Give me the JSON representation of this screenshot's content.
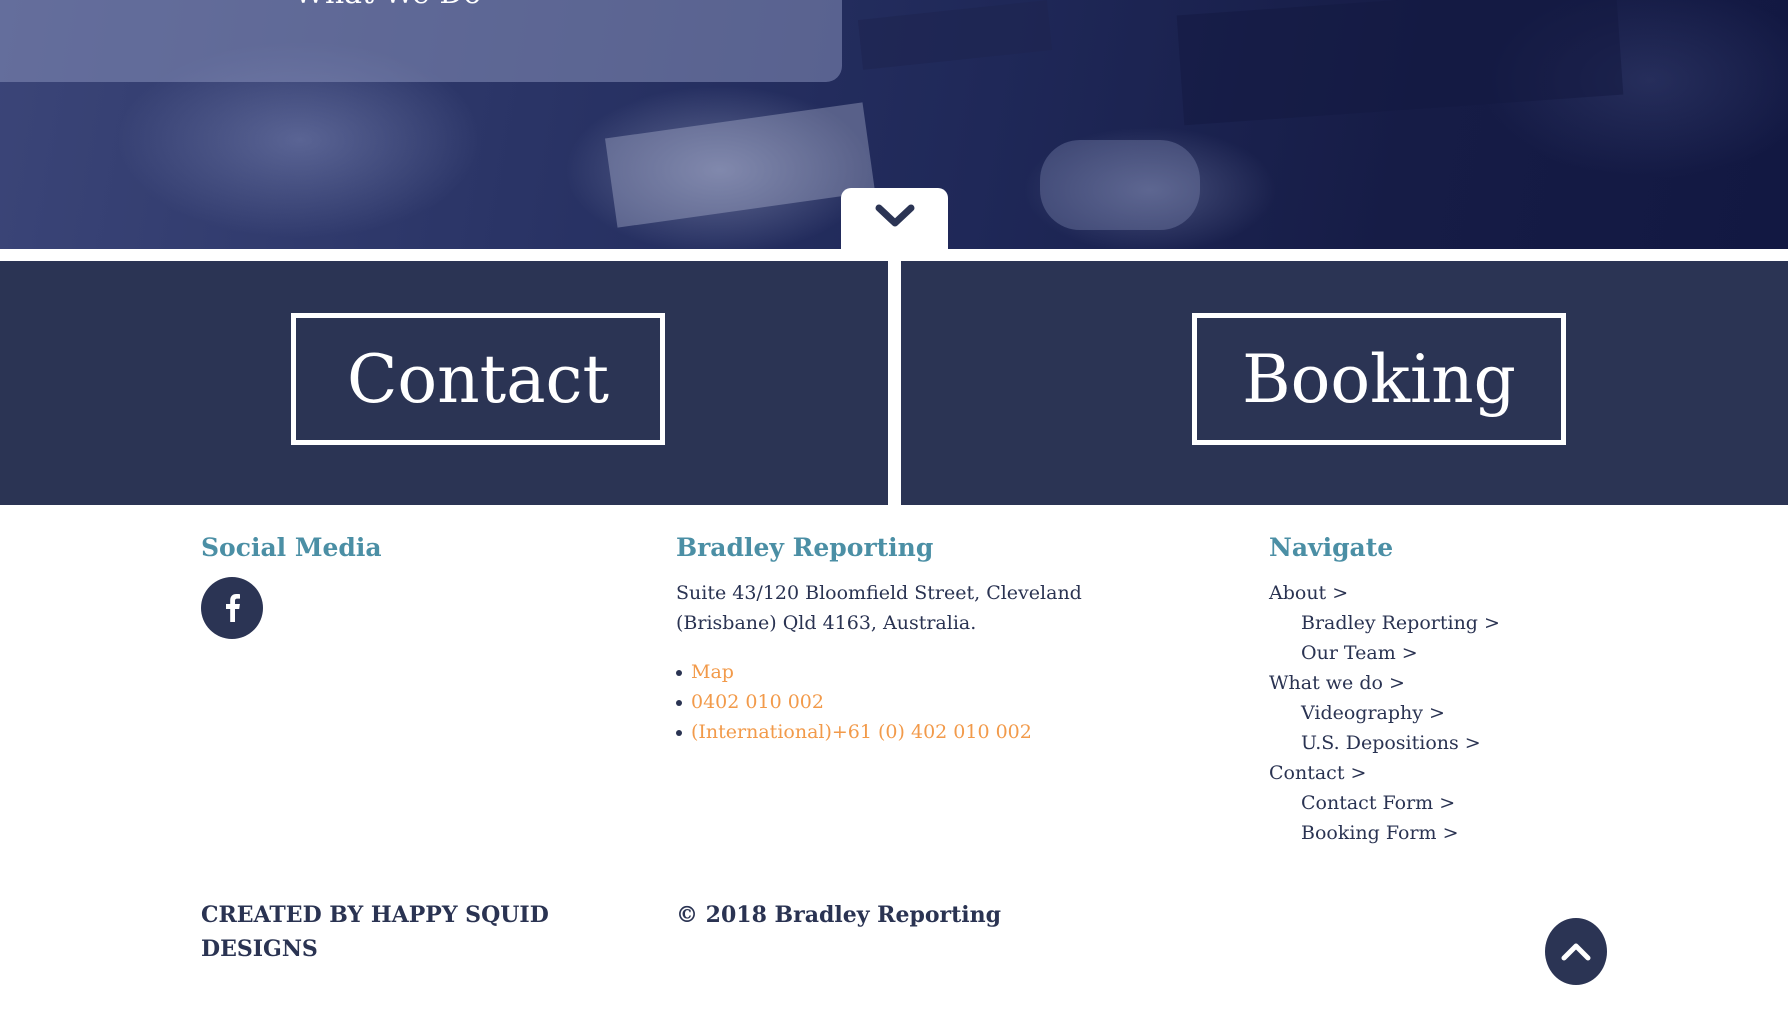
{
  "hero": {
    "title": "What We Do",
    "scroll_down_icon": "chevron-down-icon"
  },
  "cta": {
    "contact_label": "Contact",
    "booking_label": "Booking"
  },
  "footer": {
    "social": {
      "heading": "Social Media",
      "facebook_icon": "facebook-icon"
    },
    "company": {
      "heading": "Bradley Reporting",
      "address_line1": "Suite 43/120 Bloomfield Street, Cleveland",
      "address_line2": "(Brisbane) Qld 4163, Australia.",
      "links": [
        {
          "label": "Map"
        },
        {
          "label": "0402 010 002"
        },
        {
          "label": "(International)+61 (0) 402 010 002"
        }
      ]
    },
    "navigate": {
      "heading": "Navigate",
      "items": [
        {
          "label": "About >",
          "level": 0
        },
        {
          "label": "Bradley Reporting >",
          "level": 1
        },
        {
          "label": "Our Team >",
          "level": 1
        },
        {
          "label": "What we do >",
          "level": 0
        },
        {
          "label": "Videography >",
          "level": 1
        },
        {
          "label": "U.S. Depositions >",
          "level": 1
        },
        {
          "label": "Contact >",
          "level": 0
        },
        {
          "label": "Contact Form >",
          "level": 1
        },
        {
          "label": "Booking Form >",
          "level": 1
        }
      ]
    },
    "credit": "CREATED BY HAPPY SQUID DESIGNS",
    "copyright": "© 2018 Bradley Reporting",
    "back_to_top_icon": "chevron-up-icon"
  },
  "colors": {
    "navy": "#2b3454",
    "heading_teal": "#4b8fa5",
    "link_orange": "#f29a4a"
  }
}
